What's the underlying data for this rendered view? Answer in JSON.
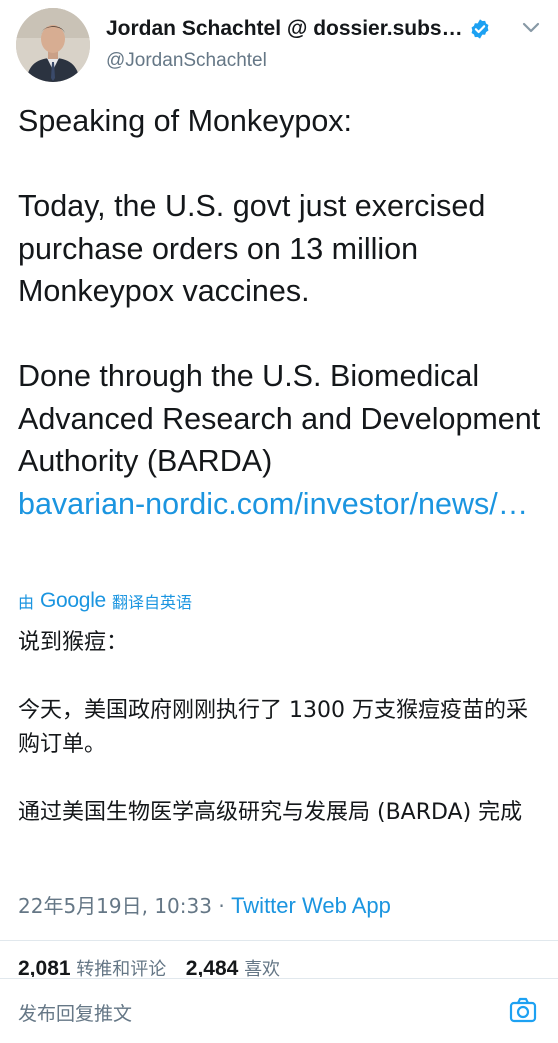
{
  "author": {
    "display_name": "Jordan Schachtel @ dossier.subs…",
    "handle": "@JordanSchachtel",
    "verified": true
  },
  "tweet": {
    "paragraphs": [
      "Speaking of Monkeypox:",
      "Today, the U.S. govt just exercised purchase orders on 13 million Monkeypox vaccines.",
      "Done through the U.S. Biomedical Advanced Research and Development Authority (BARDA)"
    ],
    "link_text": "bavarian-nordic.com/investor/news/…"
  },
  "translation": {
    "prefix": "由",
    "provider": "Google",
    "suffix": "翻译自英语",
    "paragraphs": [
      "说到猴痘：",
      "今天，美国政府刚刚执行了 1300 万支猴痘疫苗的采购订单。",
      "通过美国生物医学高级研究与发展局 (BARDA) 完成"
    ]
  },
  "meta": {
    "timestamp": "22年5月19日, 10:33",
    "separator": " · ",
    "app": "Twitter Web App"
  },
  "stats": {
    "retweets_count": "2,081",
    "retweets_label": "转推和评论",
    "likes_count": "2,484",
    "likes_label": "喜欢"
  },
  "reply": {
    "placeholder": "发布回复推文"
  },
  "colors": {
    "link": "#1b95e0",
    "secondary": "#657786",
    "text": "#14171a",
    "divider": "#e1e8ed"
  },
  "icons": [
    "verified-icon",
    "chevron-down-icon",
    "camera-icon"
  ]
}
